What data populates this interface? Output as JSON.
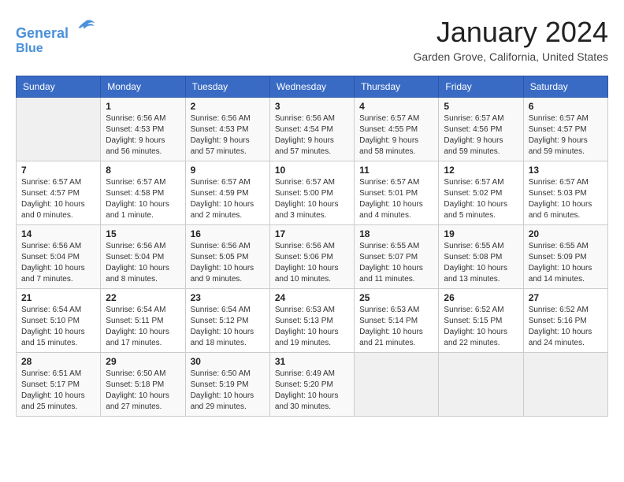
{
  "header": {
    "logo_line1": "General",
    "logo_line2": "Blue",
    "month": "January 2024",
    "location": "Garden Grove, California, United States"
  },
  "days_of_week": [
    "Sunday",
    "Monday",
    "Tuesday",
    "Wednesday",
    "Thursday",
    "Friday",
    "Saturday"
  ],
  "weeks": [
    [
      {
        "day": "",
        "info": ""
      },
      {
        "day": "1",
        "info": "Sunrise: 6:56 AM\nSunset: 4:53 PM\nDaylight: 9 hours\nand 56 minutes."
      },
      {
        "day": "2",
        "info": "Sunrise: 6:56 AM\nSunset: 4:53 PM\nDaylight: 9 hours\nand 57 minutes."
      },
      {
        "day": "3",
        "info": "Sunrise: 6:56 AM\nSunset: 4:54 PM\nDaylight: 9 hours\nand 57 minutes."
      },
      {
        "day": "4",
        "info": "Sunrise: 6:57 AM\nSunset: 4:55 PM\nDaylight: 9 hours\nand 58 minutes."
      },
      {
        "day": "5",
        "info": "Sunrise: 6:57 AM\nSunset: 4:56 PM\nDaylight: 9 hours\nand 59 minutes."
      },
      {
        "day": "6",
        "info": "Sunrise: 6:57 AM\nSunset: 4:57 PM\nDaylight: 9 hours\nand 59 minutes."
      }
    ],
    [
      {
        "day": "7",
        "info": "Sunrise: 6:57 AM\nSunset: 4:57 PM\nDaylight: 10 hours\nand 0 minutes."
      },
      {
        "day": "8",
        "info": "Sunrise: 6:57 AM\nSunset: 4:58 PM\nDaylight: 10 hours\nand 1 minute."
      },
      {
        "day": "9",
        "info": "Sunrise: 6:57 AM\nSunset: 4:59 PM\nDaylight: 10 hours\nand 2 minutes."
      },
      {
        "day": "10",
        "info": "Sunrise: 6:57 AM\nSunset: 5:00 PM\nDaylight: 10 hours\nand 3 minutes."
      },
      {
        "day": "11",
        "info": "Sunrise: 6:57 AM\nSunset: 5:01 PM\nDaylight: 10 hours\nand 4 minutes."
      },
      {
        "day": "12",
        "info": "Sunrise: 6:57 AM\nSunset: 5:02 PM\nDaylight: 10 hours\nand 5 minutes."
      },
      {
        "day": "13",
        "info": "Sunrise: 6:57 AM\nSunset: 5:03 PM\nDaylight: 10 hours\nand 6 minutes."
      }
    ],
    [
      {
        "day": "14",
        "info": "Sunrise: 6:56 AM\nSunset: 5:04 PM\nDaylight: 10 hours\nand 7 minutes."
      },
      {
        "day": "15",
        "info": "Sunrise: 6:56 AM\nSunset: 5:04 PM\nDaylight: 10 hours\nand 8 minutes."
      },
      {
        "day": "16",
        "info": "Sunrise: 6:56 AM\nSunset: 5:05 PM\nDaylight: 10 hours\nand 9 minutes."
      },
      {
        "day": "17",
        "info": "Sunrise: 6:56 AM\nSunset: 5:06 PM\nDaylight: 10 hours\nand 10 minutes."
      },
      {
        "day": "18",
        "info": "Sunrise: 6:55 AM\nSunset: 5:07 PM\nDaylight: 10 hours\nand 11 minutes."
      },
      {
        "day": "19",
        "info": "Sunrise: 6:55 AM\nSunset: 5:08 PM\nDaylight: 10 hours\nand 13 minutes."
      },
      {
        "day": "20",
        "info": "Sunrise: 6:55 AM\nSunset: 5:09 PM\nDaylight: 10 hours\nand 14 minutes."
      }
    ],
    [
      {
        "day": "21",
        "info": "Sunrise: 6:54 AM\nSunset: 5:10 PM\nDaylight: 10 hours\nand 15 minutes."
      },
      {
        "day": "22",
        "info": "Sunrise: 6:54 AM\nSunset: 5:11 PM\nDaylight: 10 hours\nand 17 minutes."
      },
      {
        "day": "23",
        "info": "Sunrise: 6:54 AM\nSunset: 5:12 PM\nDaylight: 10 hours\nand 18 minutes."
      },
      {
        "day": "24",
        "info": "Sunrise: 6:53 AM\nSunset: 5:13 PM\nDaylight: 10 hours\nand 19 minutes."
      },
      {
        "day": "25",
        "info": "Sunrise: 6:53 AM\nSunset: 5:14 PM\nDaylight: 10 hours\nand 21 minutes."
      },
      {
        "day": "26",
        "info": "Sunrise: 6:52 AM\nSunset: 5:15 PM\nDaylight: 10 hours\nand 22 minutes."
      },
      {
        "day": "27",
        "info": "Sunrise: 6:52 AM\nSunset: 5:16 PM\nDaylight: 10 hours\nand 24 minutes."
      }
    ],
    [
      {
        "day": "28",
        "info": "Sunrise: 6:51 AM\nSunset: 5:17 PM\nDaylight: 10 hours\nand 25 minutes."
      },
      {
        "day": "29",
        "info": "Sunrise: 6:50 AM\nSunset: 5:18 PM\nDaylight: 10 hours\nand 27 minutes."
      },
      {
        "day": "30",
        "info": "Sunrise: 6:50 AM\nSunset: 5:19 PM\nDaylight: 10 hours\nand 29 minutes."
      },
      {
        "day": "31",
        "info": "Sunrise: 6:49 AM\nSunset: 5:20 PM\nDaylight: 10 hours\nand 30 minutes."
      },
      {
        "day": "",
        "info": ""
      },
      {
        "day": "",
        "info": ""
      },
      {
        "day": "",
        "info": ""
      }
    ]
  ]
}
